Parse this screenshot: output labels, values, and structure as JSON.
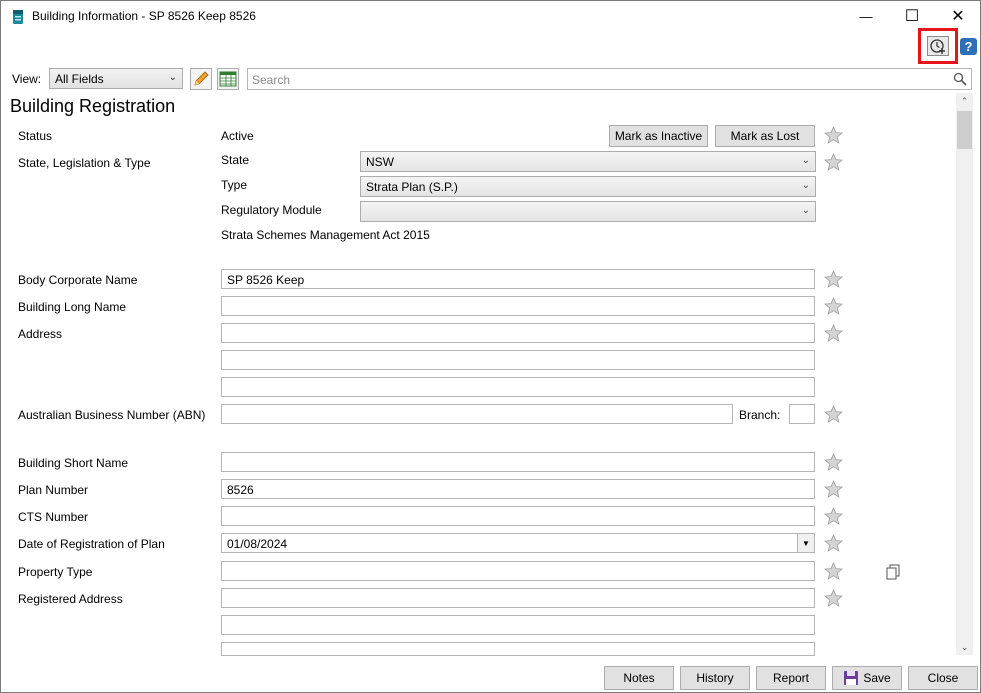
{
  "window": {
    "title": "Building Information - SP 8526 Keep 8526",
    "minimize_glyph": "—",
    "maximize_glyph": "☐",
    "close_glyph": "✕"
  },
  "toolbar": {
    "add_icon": "add-schedule-icon",
    "help_label": "?",
    "view_label": "View:",
    "view_value": "All Fields",
    "search_placeholder": "Search",
    "highlight_color": "#e8141c"
  },
  "section": {
    "title": "Building Registration"
  },
  "status": {
    "label": "Status",
    "value": "Active",
    "mark_inactive": "Mark as Inactive",
    "mark_lost": "Mark as Lost"
  },
  "legislation": {
    "label": "State, Legislation & Type",
    "state_label": "State",
    "state_value": "NSW",
    "type_label": "Type",
    "type_value": "Strata Plan (S.P.)",
    "module_label": "Regulatory Module",
    "module_value": "",
    "act_text": "Strata Schemes Management Act 2015"
  },
  "fields": {
    "body_corporate_label": "Body Corporate Name",
    "body_corporate_value": "SP 8526 Keep",
    "long_name_label": "Building Long Name",
    "long_name_value": "",
    "address_label": "Address",
    "address_line1": "",
    "address_line2": "",
    "address_line3": "",
    "abn_label": "Australian Business Number (ABN)",
    "abn_value": "",
    "branch_label": "Branch:",
    "branch_value": "",
    "short_name_label": "Building Short Name",
    "short_name_value": "",
    "plan_number_label": "Plan Number",
    "plan_number_value": "8526",
    "cts_label": "CTS Number",
    "cts_value": "",
    "date_reg_label": "Date of Registration of Plan",
    "date_reg_value": "01/08/2024",
    "property_type_label": "Property Type",
    "property_type_value": "",
    "registered_address_label": "Registered Address",
    "registered_address_line1": "",
    "registered_address_line2": "",
    "registered_address_line3": ""
  },
  "footer": {
    "notes": "Notes",
    "history": "History",
    "report": "Report",
    "save": "Save",
    "close": "Close"
  }
}
